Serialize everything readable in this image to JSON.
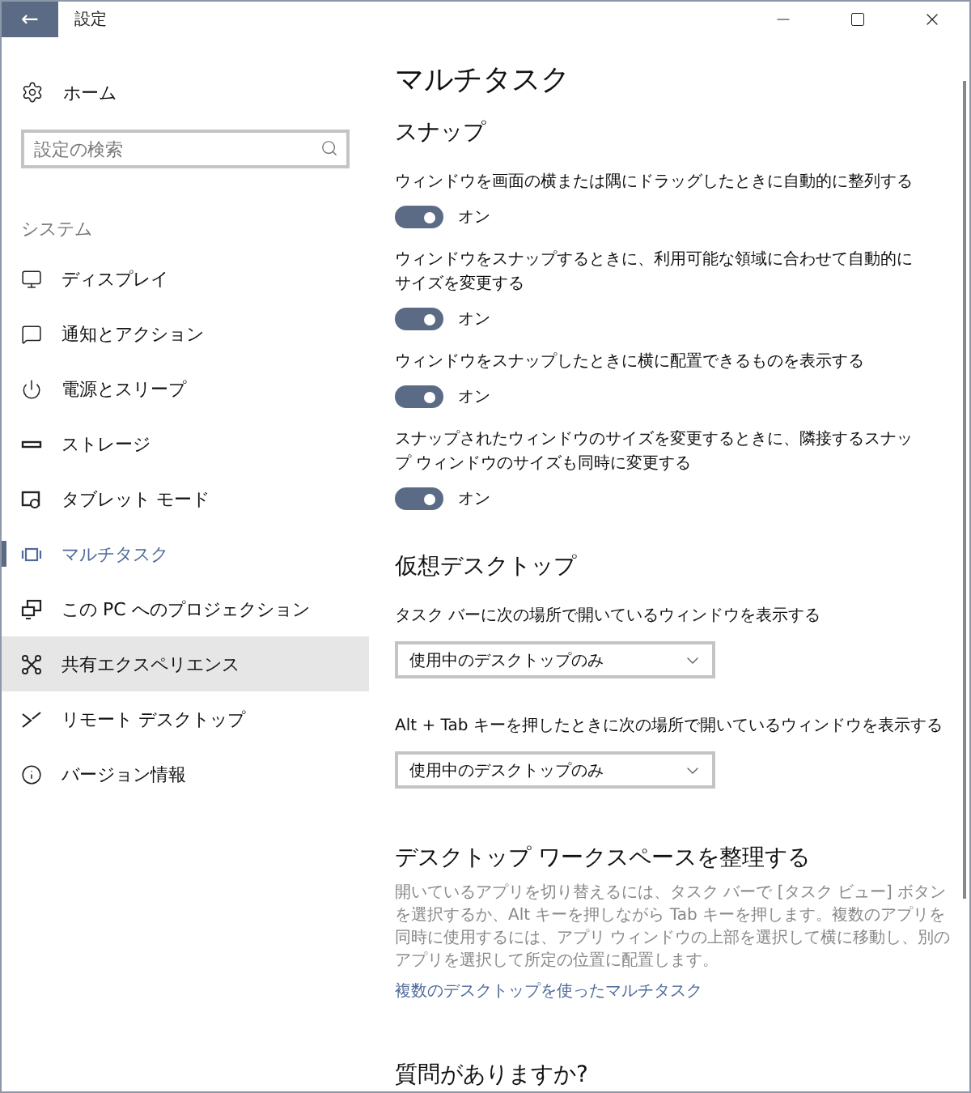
{
  "window": {
    "title": "設定",
    "back": "←"
  },
  "sidebar": {
    "home": "ホーム",
    "search": {
      "placeholder": "設定の検索"
    },
    "group": "システム",
    "items": [
      {
        "label": "ディスプレイ",
        "selected": false,
        "hovered": false
      },
      {
        "label": "通知とアクション",
        "selected": false,
        "hovered": false
      },
      {
        "label": "電源とスリープ",
        "selected": false,
        "hovered": false
      },
      {
        "label": "ストレージ",
        "selected": false,
        "hovered": false
      },
      {
        "label": "タブレット モード",
        "selected": false,
        "hovered": false
      },
      {
        "label": "マルチタスク",
        "selected": true,
        "hovered": false
      },
      {
        "label": "この PC へのプロジェクション",
        "selected": false,
        "hovered": false
      },
      {
        "label": "共有エクスペリエンス",
        "selected": false,
        "hovered": true
      },
      {
        "label": "リモート デスクトップ",
        "selected": false,
        "hovered": false
      },
      {
        "label": "バージョン情報",
        "selected": false,
        "hovered": false
      }
    ]
  },
  "page": {
    "title": "マルチタスク",
    "snap": {
      "heading": "スナップ",
      "settings": [
        {
          "label": "ウィンドウを画面の横または隅にドラッグしたときに自動的に整列する",
          "on": true,
          "state": "オン"
        },
        {
          "label": "ウィンドウをスナップするときに、利用可能な領域に合わせて自動的にサイズを変更する",
          "on": true,
          "state": "オン"
        },
        {
          "label": "ウィンドウをスナップしたときに横に配置できるものを表示する",
          "on": true,
          "state": "オン"
        },
        {
          "label": "スナップされたウィンドウのサイズを変更するときに、隣接するスナップ ウィンドウのサイズも同時に変更する",
          "on": true,
          "state": "オン"
        }
      ]
    },
    "virtual": {
      "heading": "仮想デスクトップ",
      "settings": [
        {
          "label": "タスク バーに次の場所で開いているウィンドウを表示する",
          "value": "使用中のデスクトップのみ"
        },
        {
          "label": "Alt + Tab キーを押したときに次の場所で開いているウィンドウを表示する",
          "value": "使用中のデスクトップのみ"
        }
      ]
    },
    "organize": {
      "heading": "デスクトップ ワークスペースを整理する",
      "text": "開いているアプリを切り替えるには、タスク バーで [タスク ビュー] ボタンを選択するか、Alt キーを押しながら Tab キーを押します。複数のアプリを同時に使用するには、アプリ ウィンドウの上部を選択して横に移動し、別のアプリを選択して所定の位置に配置します。",
      "link": "複数のデスクトップを使ったマルチタスク"
    },
    "questions": {
      "heading": "質問がありますか?"
    }
  }
}
